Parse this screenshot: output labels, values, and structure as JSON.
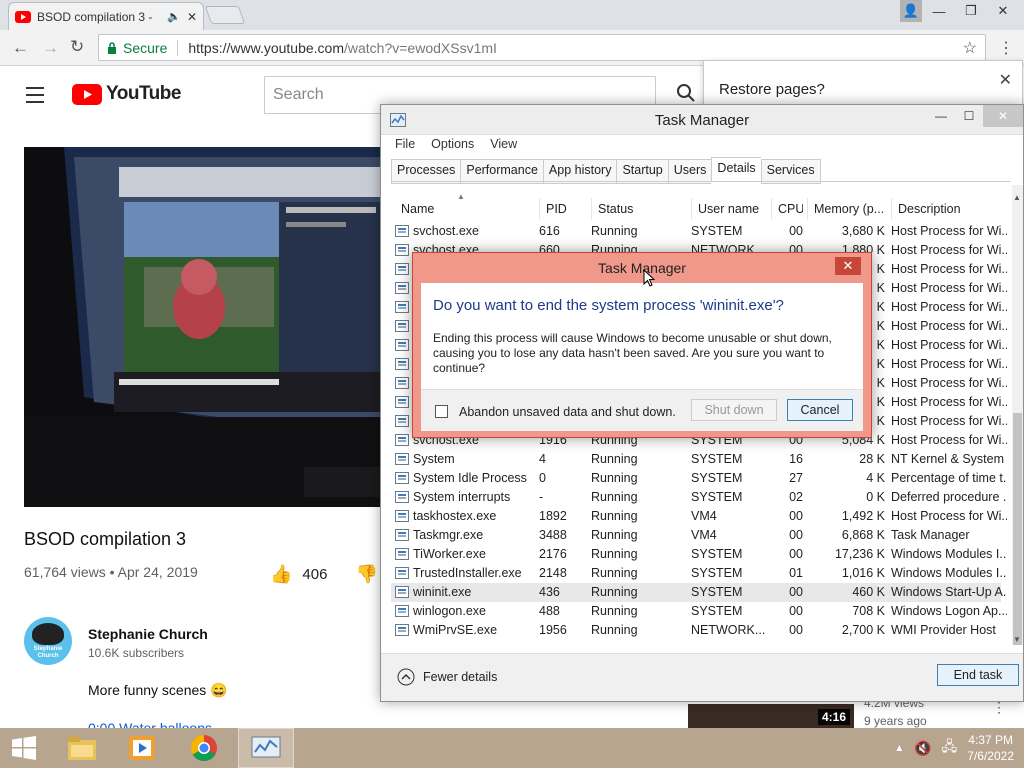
{
  "browser": {
    "tab_title": "BSOD compilation 3 -",
    "secure_label": "Secure",
    "url_prefix": "https://www.youtube.com",
    "url_path": "/watch?v=ewodXSsv1mI"
  },
  "restore": {
    "text": "Restore pages?"
  },
  "youtube": {
    "logo_text": "YouTube",
    "search_placeholder": "Search",
    "video_title": "BSOD compilation 3",
    "video_meta": "61,764 views • Apr 24, 2019",
    "likes": "406",
    "dislike_partial": "D",
    "channel_name": "Stephanie Church",
    "channel_avatar_text": "Stephanie Church",
    "subscribers": "10.6K subscribers",
    "description": "More funny scenes 😄",
    "timestamp_line": "0:00 Water balloons",
    "rec_duration": "4:16",
    "rec_views": "4.2M views",
    "rec_age": "9 years ago"
  },
  "task_manager": {
    "title": "Task Manager",
    "menu": [
      "File",
      "Options",
      "View"
    ],
    "tabs": [
      "Processes",
      "Performance",
      "App history",
      "Startup",
      "Users",
      "Details",
      "Services"
    ],
    "active_tab": "Details",
    "columns": [
      "Name",
      "PID",
      "Status",
      "User name",
      "CPU",
      "Memory (p...",
      "Description"
    ],
    "rows": [
      {
        "name": "svchost.exe",
        "pid": "616",
        "status": "Running",
        "user": "SYSTEM",
        "cpu": "00",
        "mem": "3,680 K",
        "desc": "Host Process for Wi..."
      },
      {
        "name": "svchost.exe",
        "pid": "660",
        "status": "Running",
        "user": "NETWORK...",
        "cpu": "00",
        "mem": "1,880 K",
        "desc": "Host Process for Wi..."
      },
      {
        "name": "svchost.exe",
        "pid": "",
        "status": "",
        "user": "",
        "cpu": "",
        "mem": "K",
        "desc": "Host Process for Wi..."
      },
      {
        "name": "svchost.exe",
        "pid": "",
        "status": "",
        "user": "",
        "cpu": "",
        "mem": "K",
        "desc": "Host Process for Wi..."
      },
      {
        "name": "svchost.exe",
        "pid": "",
        "status": "",
        "user": "",
        "cpu": "",
        "mem": "K",
        "desc": "Host Process for Wi..."
      },
      {
        "name": "svchost.exe",
        "pid": "",
        "status": "",
        "user": "",
        "cpu": "",
        "mem": "K",
        "desc": "Host Process for Wi..."
      },
      {
        "name": "svchost.exe",
        "pid": "",
        "status": "",
        "user": "",
        "cpu": "",
        "mem": "K",
        "desc": "Host Process for Wi..."
      },
      {
        "name": "svchost.exe",
        "pid": "",
        "status": "",
        "user": "",
        "cpu": "",
        "mem": "K",
        "desc": "Host Process for Wi..."
      },
      {
        "name": "svchost.exe",
        "pid": "",
        "status": "",
        "user": "",
        "cpu": "",
        "mem": "K",
        "desc": "Host Process for Wi..."
      },
      {
        "name": "svchost.exe",
        "pid": "",
        "status": "",
        "user": "",
        "cpu": "",
        "mem": "K",
        "desc": "Host Process for Wi..."
      },
      {
        "name": "svchost.exe",
        "pid": "",
        "status": "",
        "user": "",
        "cpu": "",
        "mem": "K",
        "desc": "Host Process for Wi..."
      },
      {
        "name": "svchost.exe",
        "pid": "1916",
        "status": "Running",
        "user": "SYSTEM",
        "cpu": "00",
        "mem": "5,084 K",
        "desc": "Host Process for Wi..."
      },
      {
        "name": "System",
        "pid": "4",
        "status": "Running",
        "user": "SYSTEM",
        "cpu": "16",
        "mem": "28 K",
        "desc": "NT Kernel & System"
      },
      {
        "name": "System Idle Process",
        "pid": "0",
        "status": "Running",
        "user": "SYSTEM",
        "cpu": "27",
        "mem": "4 K",
        "desc": "Percentage of time t..."
      },
      {
        "name": "System interrupts",
        "pid": "-",
        "status": "Running",
        "user": "SYSTEM",
        "cpu": "02",
        "mem": "0 K",
        "desc": "Deferred procedure ..."
      },
      {
        "name": "taskhostex.exe",
        "pid": "1892",
        "status": "Running",
        "user": "VM4",
        "cpu": "00",
        "mem": "1,492 K",
        "desc": "Host Process for Wi..."
      },
      {
        "name": "Taskmgr.exe",
        "pid": "3488",
        "status": "Running",
        "user": "VM4",
        "cpu": "00",
        "mem": "6,868 K",
        "desc": "Task Manager"
      },
      {
        "name": "TiWorker.exe",
        "pid": "2176",
        "status": "Running",
        "user": "SYSTEM",
        "cpu": "00",
        "mem": "17,236 K",
        "desc": "Windows Modules I..."
      },
      {
        "name": "TrustedInstaller.exe",
        "pid": "2148",
        "status": "Running",
        "user": "SYSTEM",
        "cpu": "01",
        "mem": "1,016 K",
        "desc": "Windows Modules I..."
      },
      {
        "name": "wininit.exe",
        "pid": "436",
        "status": "Running",
        "user": "SYSTEM",
        "cpu": "00",
        "mem": "460 K",
        "desc": "Windows Start-Up A..."
      },
      {
        "name": "winlogon.exe",
        "pid": "488",
        "status": "Running",
        "user": "SYSTEM",
        "cpu": "00",
        "mem": "708 K",
        "desc": "Windows Logon Ap..."
      },
      {
        "name": "WmiPrvSE.exe",
        "pid": "1956",
        "status": "Running",
        "user": "NETWORK...",
        "cpu": "00",
        "mem": "2,700 K",
        "desc": "WMI Provider Host"
      }
    ],
    "selected_row": "wininit.exe",
    "fewer_details": "Fewer details",
    "end_task": "End task"
  },
  "dialog": {
    "title": "Task Manager",
    "question": "Do you want to end the system process 'wininit.exe'?",
    "message": "Ending this process will cause Windows to become unusable or shut down, causing you to lose any data hasn't been saved. Are you sure you want to continue?",
    "checkbox_label": "Abandon unsaved data and shut down.",
    "checkbox_checked": false,
    "shutdown_label": "Shut down",
    "cancel_label": "Cancel"
  },
  "taskbar": {
    "time": "4:37 PM",
    "date": "7/6/2022",
    "apps": [
      "file-explorer",
      "media-player",
      "chrome",
      "task-manager"
    ]
  },
  "colors": {
    "youtube_red": "#ff0000",
    "dialog_accent": "#f0998b",
    "taskbar": "#b8a58f"
  }
}
